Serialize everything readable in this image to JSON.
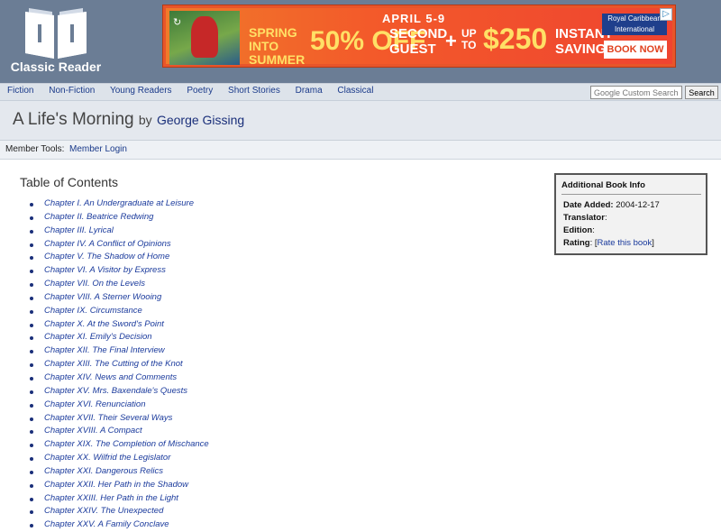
{
  "logo": {
    "text": "Classic Reader",
    "icon": "open-book-icon"
  },
  "ad": {
    "date": "APRIL 5-9",
    "spring": "SPRING INTO SUMMER",
    "discount": "50% OFF",
    "second": "SECOND GUEST",
    "plus": "+",
    "upto": "UP TO",
    "amount": "$250",
    "savings": "INSTANT SAVINGS",
    "brand": "Royal Caribbean International",
    "cta": "BOOK NOW",
    "choice_icon": "adchoices-icon",
    "replay_icon": "replay-icon"
  },
  "nav": {
    "items": [
      "Fiction",
      "Non-Fiction",
      "Young Readers",
      "Poetry",
      "Short Stories",
      "Drama",
      "Classical"
    ],
    "search_placeholder": "Google Custom Search",
    "search_button": "Search"
  },
  "book": {
    "title": "A Life's Morning",
    "by": "by",
    "author": "George Gissing"
  },
  "member": {
    "label": "Member Tools:",
    "login": "Member Login"
  },
  "toc": {
    "heading": "Table of Contents",
    "chapters": [
      "Chapter I. An Undergraduate at Leisure",
      "Chapter II. Beatrice Redwing",
      "Chapter III. Lyrical",
      "Chapter IV. A Conflict of Opinions",
      "Chapter V. The Shadow of Home",
      "Chapter VI. A Visitor by Express",
      "Chapter VII. On the Levels",
      "Chapter VIII. A Sterner Wooing",
      "Chapter IX. Circumstance",
      "Chapter X. At the Sword's Point",
      "Chapter XI. Emily's Decision",
      "Chapter XII. The Final Interview",
      "Chapter XIII. The Cutting of the Knot",
      "Chapter XIV. News and Comments",
      "Chapter XV. Mrs. Baxendale's Quests",
      "Chapter XVI. Renunciation",
      "Chapter XVII. Their Several Ways",
      "Chapter XVIII. A Compact",
      "Chapter XIX. The Completion of Mischance",
      "Chapter XX. Wilfrid the Legislator",
      "Chapter XXI. Dangerous Relics",
      "Chapter XXII. Her Path in the Shadow",
      "Chapter XXIII. Her Path in the Light",
      "Chapter XXIV. The Unexpected",
      "Chapter XXV. A Family Conclave"
    ]
  },
  "info": {
    "title": "Additional Book Info",
    "date_added_label": "Date Added:",
    "date_added": "2004-12-17",
    "translator_label": "Translator",
    "edition_label": "Edition",
    "rating_label": "Rating",
    "rating_link": "Rate this book",
    "colon": ":",
    "open_bracket": "[",
    "close_bracket": "]"
  },
  "colors": {
    "header_bg": "#6b7d95",
    "link": "#1a3a9c",
    "nav_bg": "#dde3ea",
    "ad_orange": "#f35a2a"
  }
}
